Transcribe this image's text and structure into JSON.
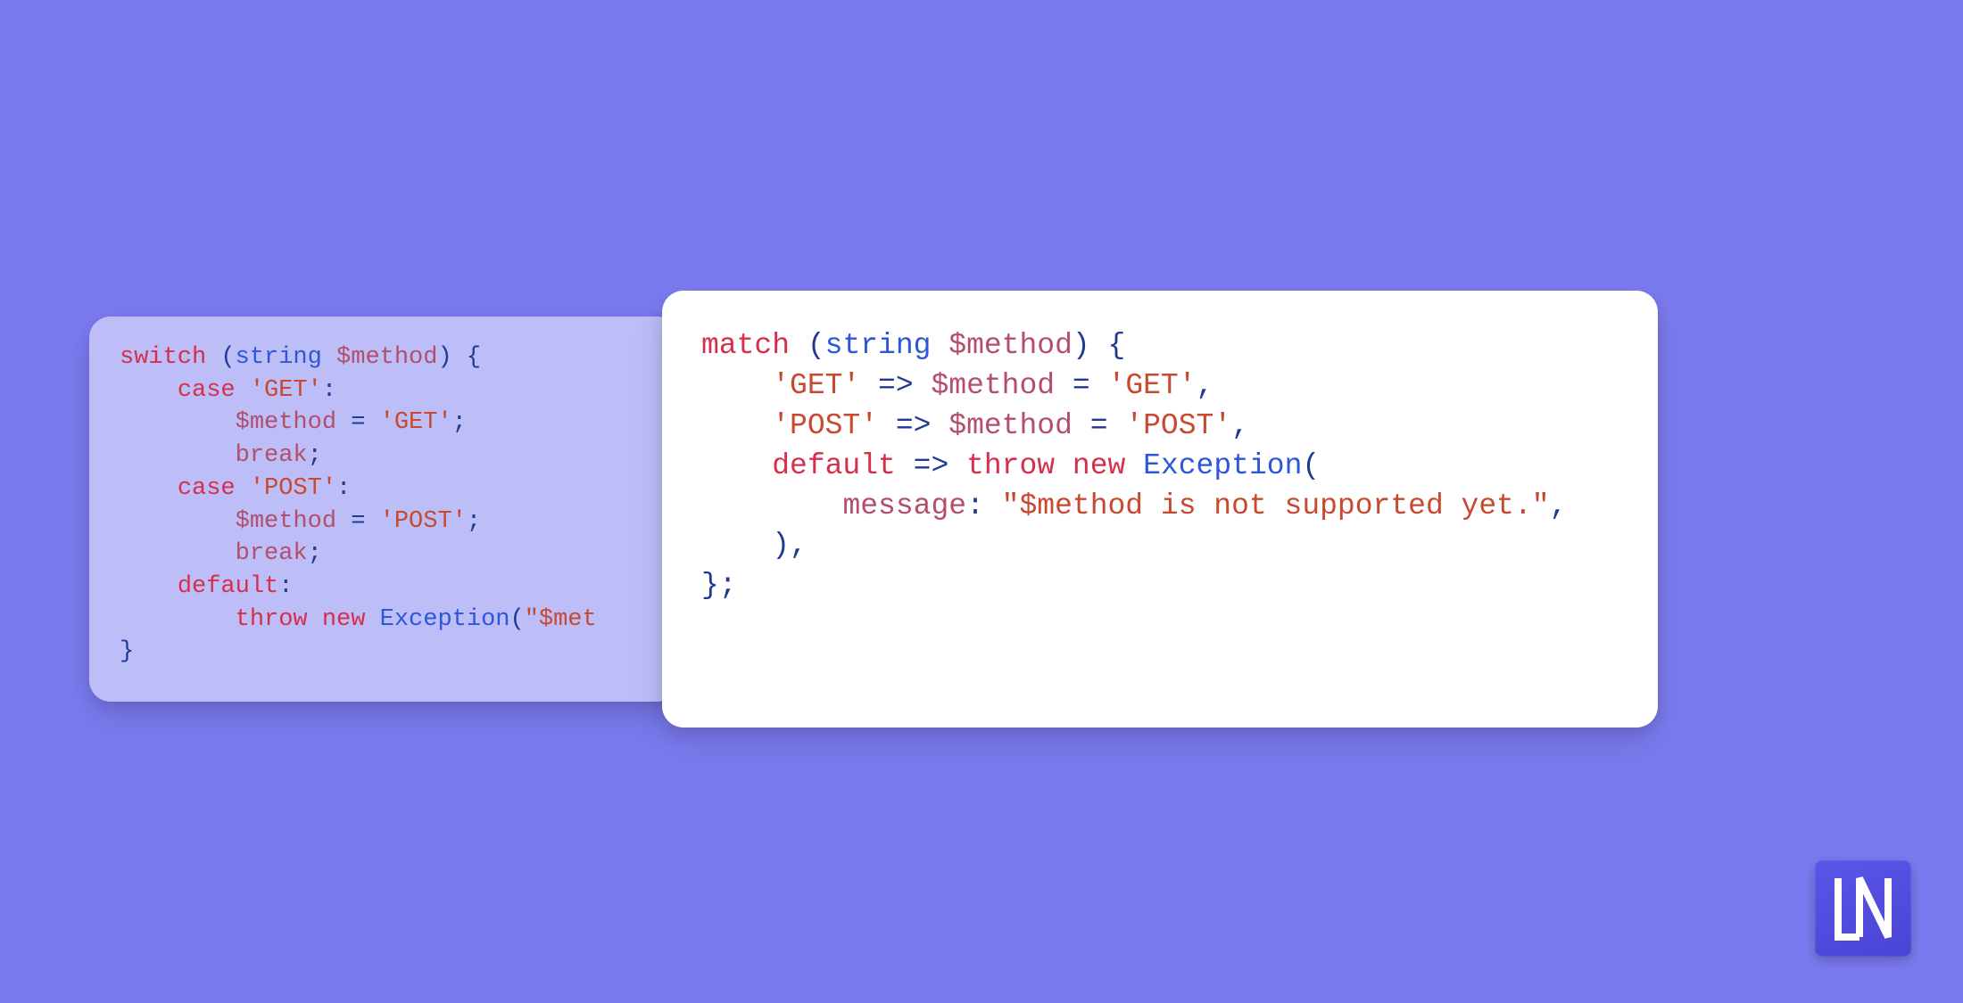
{
  "logo": {
    "text": "LN"
  },
  "left": {
    "l0a": "switch",
    "l0b": " (",
    "l0c": "string",
    "l0d": " ",
    "l0e": "$method",
    "l0f": ") {",
    "l1a": "    ",
    "l1b": "case",
    "l1c": " ",
    "l1d": "'GET'",
    "l1e": ":",
    "l2a": "        ",
    "l2b": "$method",
    "l2c": " = ",
    "l2d": "'GET'",
    "l2e": ";",
    "l3a": "        ",
    "l3b": "break",
    "l3c": ";",
    "l4a": "    ",
    "l4b": "case",
    "l4c": " ",
    "l4d": "'POST'",
    "l4e": ":",
    "l5a": "        ",
    "l5b": "$method",
    "l5c": " = ",
    "l5d": "'POST'",
    "l5e": ";",
    "l6a": "        ",
    "l6b": "break",
    "l6c": ";",
    "l7a": "    ",
    "l7b": "default",
    "l7c": ":",
    "l8a": "        ",
    "l8b": "throw",
    "l8c": " ",
    "l8d": "new",
    "l8e": " ",
    "l8f": "Exception",
    "l8g": "(",
    "l8h": "\"$met",
    "l9a": "}"
  },
  "right": {
    "r0a": "match",
    "r0b": " (",
    "r0c": "string",
    "r0d": " ",
    "r0e": "$method",
    "r0f": ") {",
    "r1a": "    ",
    "r1b": "'GET'",
    "r1c": " => ",
    "r1d": "$method",
    "r1e": " = ",
    "r1f": "'GET'",
    "r1g": ",",
    "r2a": "    ",
    "r2b": "'POST'",
    "r2c": " => ",
    "r2d": "$method",
    "r2e": " = ",
    "r2f": "'POST'",
    "r2g": ",",
    "r3a": "    ",
    "r3b": "default",
    "r3c": " => ",
    "r3d": "throw",
    "r3e": " ",
    "r3f": "new",
    "r3g": " ",
    "r3h": "Exception",
    "r3i": "(",
    "r4a": "        ",
    "r4b": "message",
    "r4c": ": ",
    "r4d": "\"$method is not supported yet.\"",
    "r4e": ",",
    "r5a": "    ),",
    "r6a": "};"
  }
}
